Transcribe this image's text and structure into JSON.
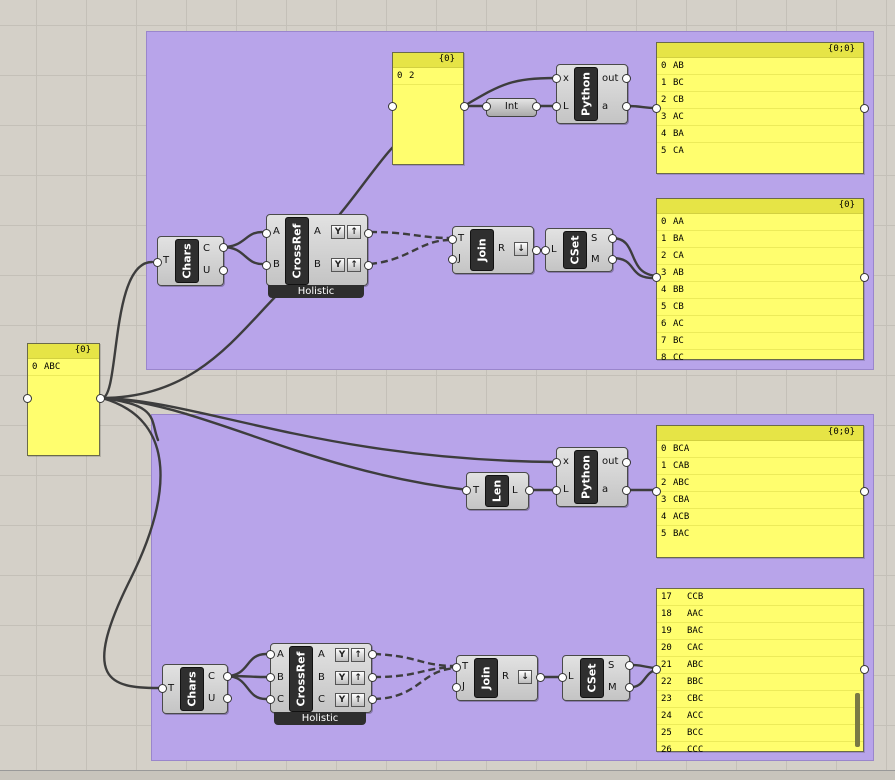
{
  "panel_chars": {
    "header": "{0}",
    "rows": [
      {
        "i": "0",
        "v": "ABC"
      }
    ]
  },
  "panel_two": {
    "header": "{0}",
    "rows": [
      {
        "i": "0",
        "v": "2"
      }
    ]
  },
  "panel_top_out": {
    "header": "{0;0}",
    "rows": [
      {
        "i": "0",
        "v": "AB"
      },
      {
        "i": "1",
        "v": "BC"
      },
      {
        "i": "2",
        "v": "CB"
      },
      {
        "i": "3",
        "v": "AC"
      },
      {
        "i": "4",
        "v": "BA"
      },
      {
        "i": "5",
        "v": "CA"
      }
    ]
  },
  "panel_top_set": {
    "header": "{0}",
    "rows": [
      {
        "i": "0",
        "v": "AA"
      },
      {
        "i": "1",
        "v": "BA"
      },
      {
        "i": "2",
        "v": "CA"
      },
      {
        "i": "3",
        "v": "AB"
      },
      {
        "i": "4",
        "v": "BB"
      },
      {
        "i": "5",
        "v": "CB"
      },
      {
        "i": "6",
        "v": "AC"
      },
      {
        "i": "7",
        "v": "BC"
      },
      {
        "i": "8",
        "v": "CC"
      }
    ]
  },
  "panel_bot_out": {
    "header": "{0;0}",
    "rows": [
      {
        "i": "0",
        "v": "BCA"
      },
      {
        "i": "1",
        "v": "CAB"
      },
      {
        "i": "2",
        "v": "ABC"
      },
      {
        "i": "3",
        "v": "CBA"
      },
      {
        "i": "4",
        "v": "ACB"
      },
      {
        "i": "5",
        "v": "BAC"
      }
    ]
  },
  "panel_bot_set": {
    "rows": [
      {
        "i": "17",
        "v": "CCB"
      },
      {
        "i": "18",
        "v": "AAC"
      },
      {
        "i": "19",
        "v": "BAC"
      },
      {
        "i": "20",
        "v": "CAC"
      },
      {
        "i": "21",
        "v": "ABC"
      },
      {
        "i": "22",
        "v": "BBC"
      },
      {
        "i": "23",
        "v": "CBC"
      },
      {
        "i": "24",
        "v": "ACC"
      },
      {
        "i": "25",
        "v": "BCC"
      },
      {
        "i": "26",
        "v": "CCC"
      }
    ]
  },
  "components": {
    "chars": {
      "name": "Chars",
      "in": "T",
      "out1": "C",
      "out2": "U"
    },
    "crossref": {
      "name": "CrossRef",
      "footer": "Holistic",
      "a": "A",
      "b": "B",
      "c": "C"
    },
    "join": {
      "name": "Join",
      "in1": "T",
      "in2": "J",
      "out": "R"
    },
    "cset": {
      "name": "CSet",
      "in": "L",
      "out1": "S",
      "out2": "M"
    },
    "python": {
      "name": "Python",
      "in1": "x",
      "in2": "L",
      "out1": "out",
      "out2": "a"
    },
    "int": {
      "name": "Int"
    },
    "len": {
      "name": "Len",
      "in": "T",
      "out": "L"
    }
  },
  "icons": {
    "graft": "graft-icon",
    "flatten": "flatten-icon",
    "simplify": "simplify-icon"
  }
}
